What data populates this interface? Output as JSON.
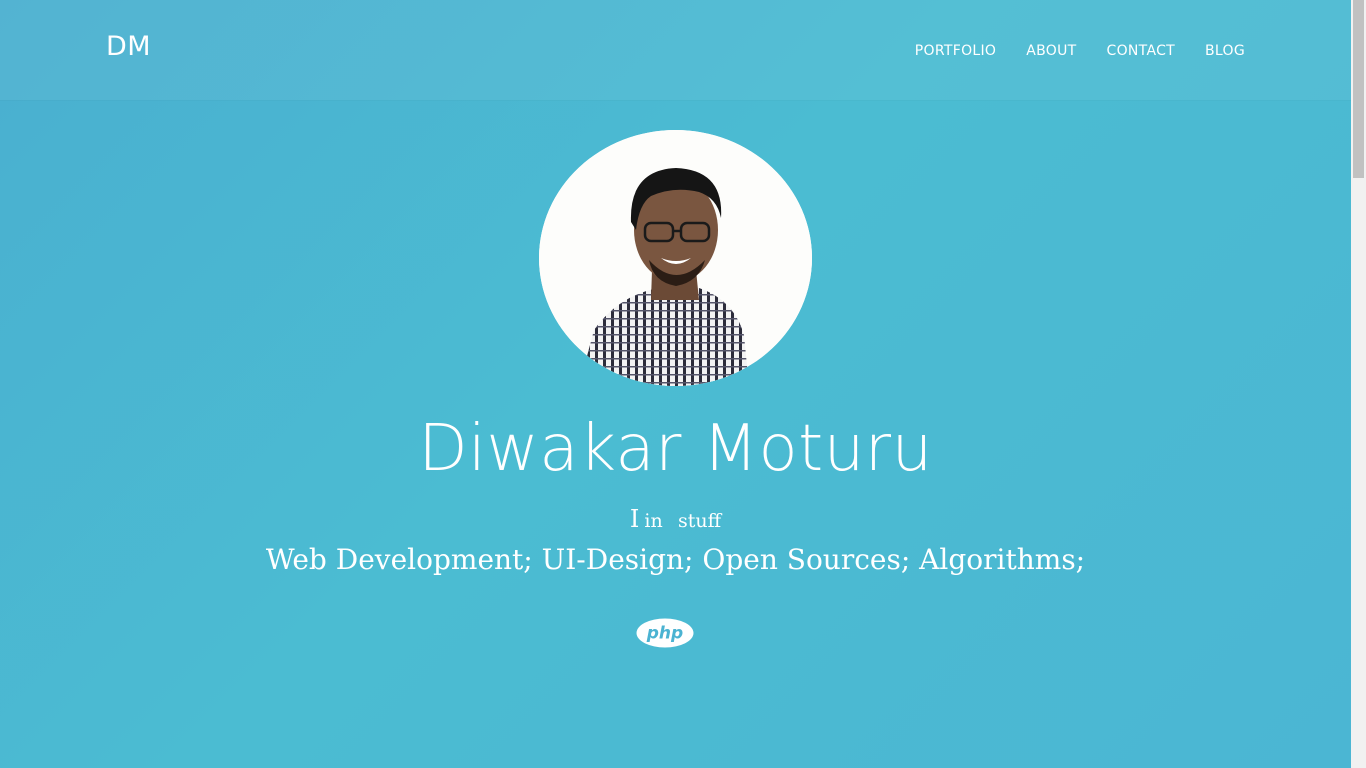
{
  "header": {
    "brand": "DM",
    "nav": [
      {
        "label": "PORTFOLIO"
      },
      {
        "label": "ABOUT"
      },
      {
        "label": "CONTACT"
      },
      {
        "label": "BLOG"
      }
    ]
  },
  "hero": {
    "avatar_alt": "profile photo",
    "name": "Diwakar Moturu",
    "tagline_i": "I",
    "tagline_in": "in",
    "tagline_stuff": "stuff",
    "skills": "Web Development; UI-Design; Open Sources; Algorithms;",
    "tech_logo_text": "php",
    "tech_logo_icon": "php-logo-icon"
  },
  "colors": {
    "background_start": "#4aafd0",
    "background_end": "#4bbcd2",
    "text": "#ffffff",
    "logo_text": "#4bb3d2"
  }
}
